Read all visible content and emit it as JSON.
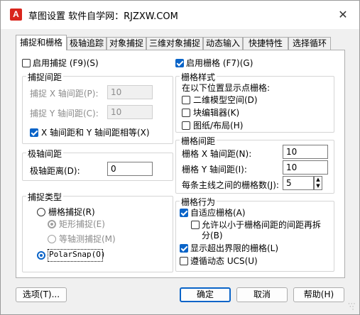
{
  "window": {
    "app_icon_letter": "A",
    "title": "草图设置   软件自学网：RJZXW.COM",
    "close_glyph": "✕"
  },
  "tabs": [
    {
      "label": "捕捉和栅格",
      "active": true
    },
    {
      "label": "极轴追踪"
    },
    {
      "label": "对象捕捉"
    },
    {
      "label": "三维对象捕捉"
    },
    {
      "label": "动态输入"
    },
    {
      "label": "快捷特性"
    },
    {
      "label": "选择循环"
    }
  ],
  "snap": {
    "enable_label": "启用捕捉 (F9)(S)",
    "enable_checked": false,
    "spacing_group": "捕捉间距",
    "x_label": "捕捉 X 轴间距(P):",
    "x_value": "10",
    "y_label": "捕捉 Y 轴间距(C):",
    "y_value": "10",
    "equal_label": "X 轴间距和 Y 轴间距相等(X)",
    "equal_checked": true
  },
  "polar": {
    "group": "极轴间距",
    "distance_label": "极轴距离(D):",
    "distance_value": "0"
  },
  "snap_type": {
    "group": "捕捉类型",
    "grid_snap_label": "栅格捕捉(R)",
    "rect_snap_label": "矩形捕捉(E)",
    "iso_snap_label": "等轴测捕捉(M)",
    "polar_snap_label": "PolarSnap(O)"
  },
  "grid": {
    "enable_label": "启用栅格 (F7)(G)",
    "enable_checked": true,
    "style_group": "栅格样式",
    "style_caption": "在以下位置显示点栅格:",
    "model_space_label": "二维模型空间(D)",
    "block_editor_label": "块编辑器(K)",
    "sheet_layout_label": "图纸/布局(H)",
    "spacing_group": "栅格间距",
    "x_label": "栅格 X 轴间距(N):",
    "x_value": "10",
    "y_label": "栅格 Y 轴间距(I):",
    "y_value": "10",
    "major_label": "每条主线之间的栅格数(J):",
    "major_value": "5",
    "behavior_group": "栅格行为",
    "adaptive_label": "自适应栅格(A)",
    "adaptive_checked": true,
    "subdivide_label_1": "允许以小于栅格间距的间距再拆",
    "subdivide_label_2": "分(B)",
    "beyond_limits_label": "显示超出界限的栅格(L)",
    "beyond_limits_checked": true,
    "follow_ucs_label": "遵循动态 UCS(U)"
  },
  "buttons": {
    "options": "选项(T)...",
    "ok": "确定",
    "cancel": "取消",
    "help": "帮助(H)"
  }
}
